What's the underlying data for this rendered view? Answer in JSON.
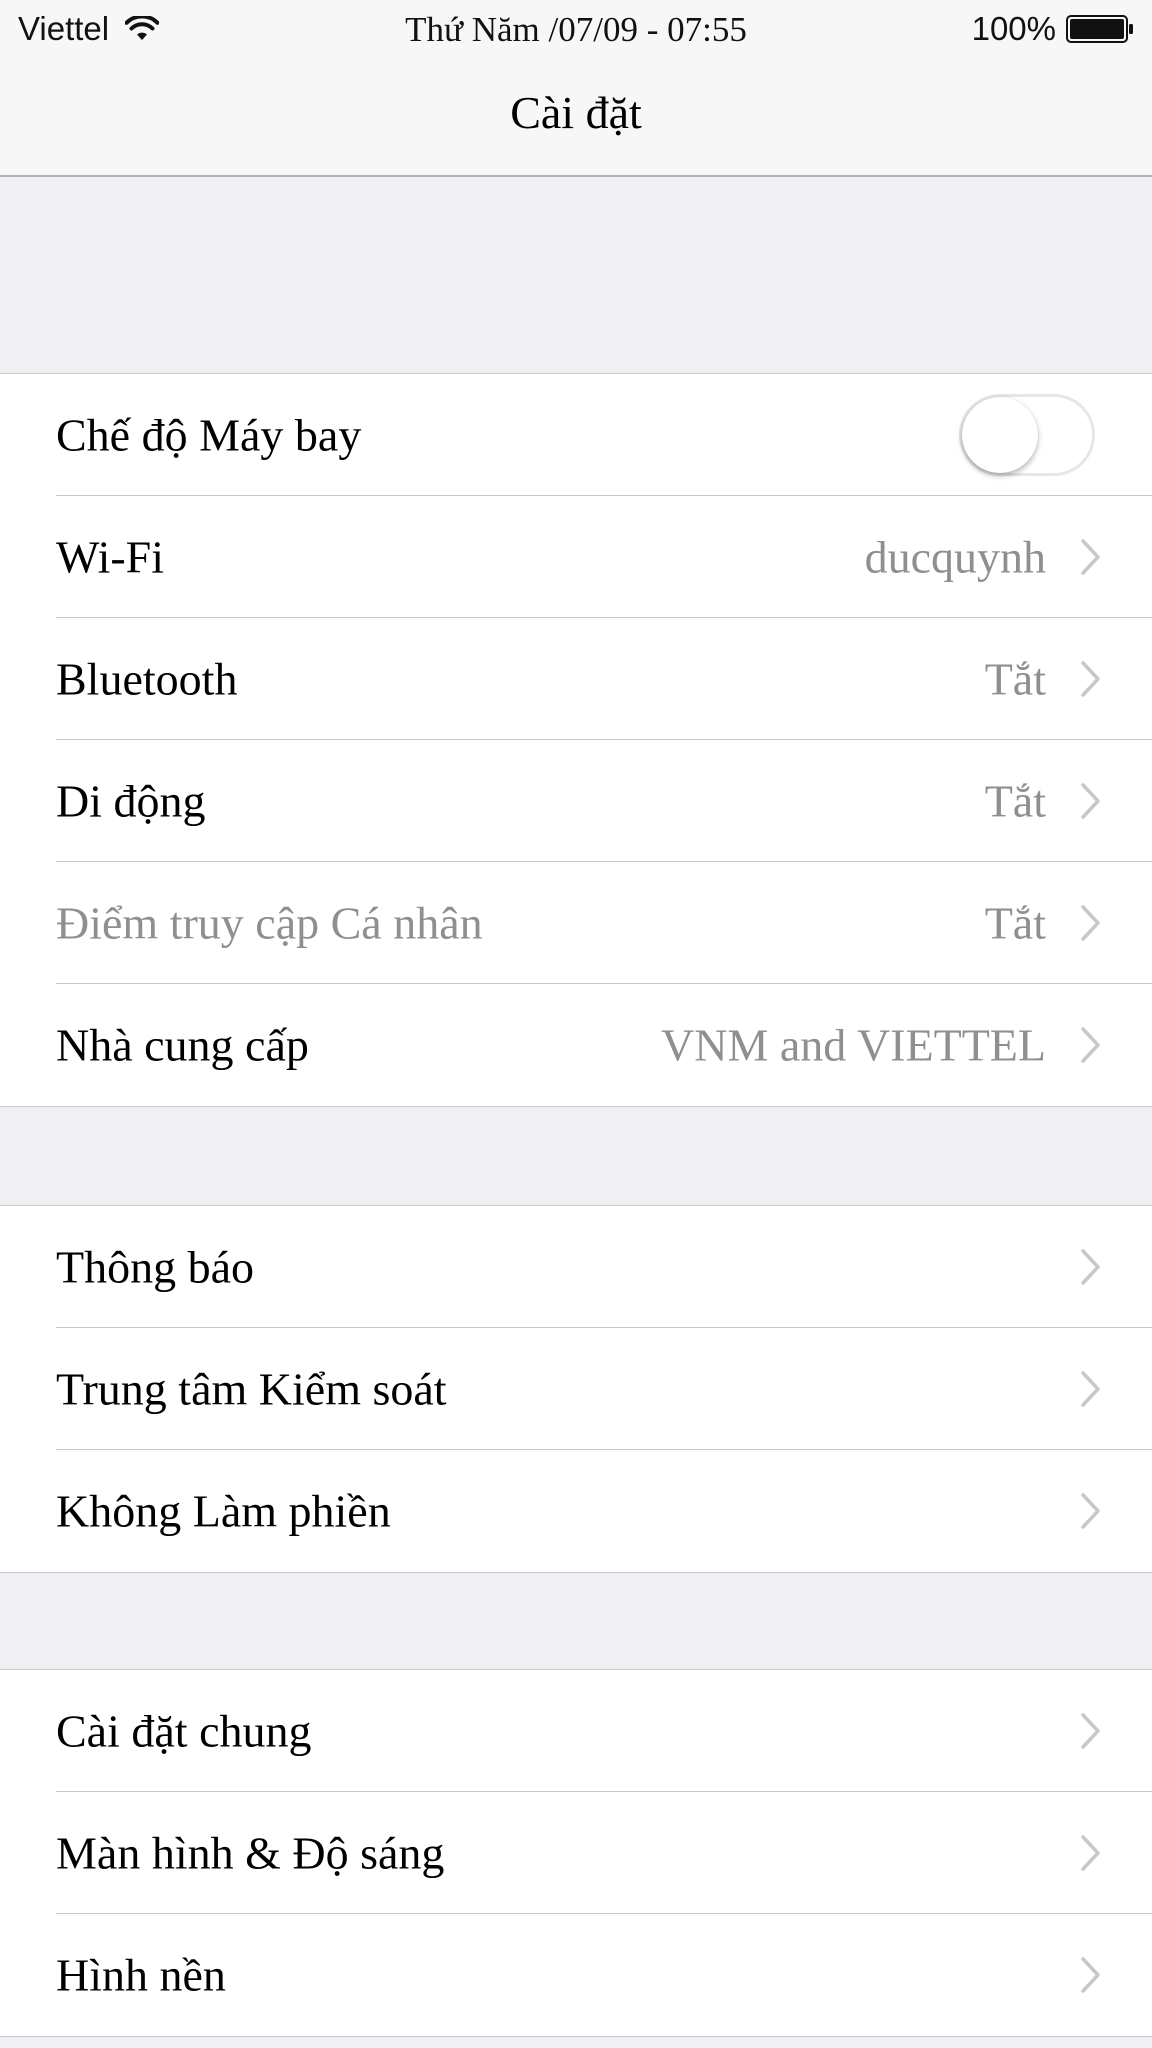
{
  "status_bar": {
    "carrier": "Viettel",
    "wifi_icon": "wifi-icon",
    "datetime": "Thứ Năm /07/09  -  07:55",
    "battery_percent": "100%",
    "battery_icon": "battery-icon",
    "battery_level": 1.0
  },
  "nav": {
    "title": "Cài đặt"
  },
  "colors": {
    "background": "#efeff4",
    "cell": "#ffffff",
    "separator": "#c8c7cc",
    "secondary_text": "#8e8e93",
    "chevron": "#c7c7cc"
  },
  "groups": [
    {
      "rows": [
        {
          "label": "Chế độ Máy bay",
          "control": "toggle",
          "toggle_on": false
        },
        {
          "label": "Wi-Fi",
          "value": "ducquynh",
          "chevron": true
        },
        {
          "label": "Bluetooth",
          "value": "Tắt",
          "chevron": true
        },
        {
          "label": "Di động",
          "value": "Tắt",
          "chevron": true
        },
        {
          "label": "Điểm truy cập Cá nhân",
          "value": "Tắt",
          "chevron": true,
          "disabled": true
        },
        {
          "label": "Nhà cung cấp",
          "value": "VNM and VIETTEL",
          "chevron": true
        }
      ]
    },
    {
      "rows": [
        {
          "label": "Thông báo",
          "chevron": true
        },
        {
          "label": "Trung tâm Kiểm soát",
          "chevron": true
        },
        {
          "label": "Không Làm phiền",
          "chevron": true
        }
      ]
    },
    {
      "rows": [
        {
          "label": "Cài đặt chung",
          "chevron": true
        },
        {
          "label": "Màn hình & Độ sáng",
          "chevron": true
        },
        {
          "label": "Hình nền",
          "chevron": true
        }
      ]
    }
  ]
}
